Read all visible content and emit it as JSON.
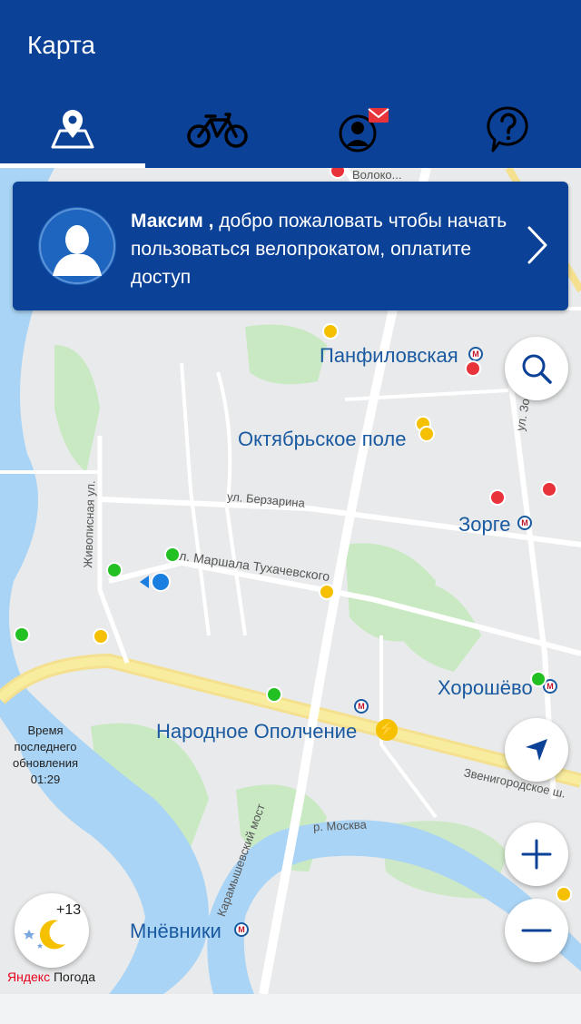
{
  "header": {
    "title": "Карта",
    "tabs": [
      {
        "name": "map",
        "icon": "map-pin-icon",
        "active": true
      },
      {
        "name": "bike",
        "icon": "bicycle-icon",
        "active": false
      },
      {
        "name": "profile",
        "icon": "profile-mail-icon",
        "active": false
      },
      {
        "name": "help",
        "icon": "question-icon",
        "active": false
      }
    ]
  },
  "banner": {
    "user_name": "Максим ,",
    "message": " добро пожаловать чтобы начать пользоваться велопрокатом, оплатите доступ"
  },
  "map": {
    "stations": [
      {
        "name": "Панфиловская"
      },
      {
        "name": "Октябрьское поле"
      },
      {
        "name": "Зорге"
      },
      {
        "name": "Хорошёво"
      },
      {
        "name": "Народное Ополчение"
      },
      {
        "name": "Мнёвники"
      }
    ],
    "streets": {
      "volokolamskoe": "Волоко...",
      "berzarina": "ул. Берзарина",
      "marshala": "ул. Маршала Тухачевского",
      "zhivopisnaya": "Живописная ул.",
      "zorge": "ул. Зорге",
      "zvenigorodskoe": "Звенигородское ш.",
      "karamyshevsky": "Карамышевский мост",
      "moskva": "р. Москва"
    },
    "colors": {
      "available": "#22c022",
      "few": "#f5c000",
      "empty": "#e8333a",
      "water": "#a8d3f5",
      "park": "#c6e8c0",
      "road_major": "#f7e07a"
    }
  },
  "last_update": {
    "label": "Время последнего обновления",
    "time": "01:29"
  },
  "weather": {
    "temp": "+13",
    "brand_ya": "Яндекс",
    "brand_rest": " Погода"
  }
}
